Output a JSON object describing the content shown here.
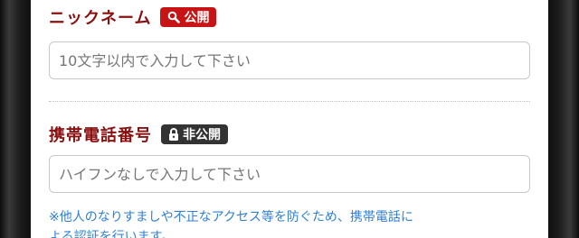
{
  "nickname": {
    "label": "ニックネーム",
    "badge": "公開",
    "badge_icon": "search-icon",
    "placeholder": "10文字以内で入力して下さい"
  },
  "phone": {
    "label": "携帯電話番号",
    "badge": "非公開",
    "badge_icon": "lock-icon",
    "placeholder": "ハイフンなしで入力して下さい",
    "note_line1": "※他人のなりすましや不正なアクセス等を防ぐため、携帯電話に",
    "note_line2": "よる認証を行います。"
  },
  "colors": {
    "label": "#8a1010",
    "public_badge": "#c81414",
    "private_badge": "#333333",
    "note": "#2f7fd4"
  }
}
